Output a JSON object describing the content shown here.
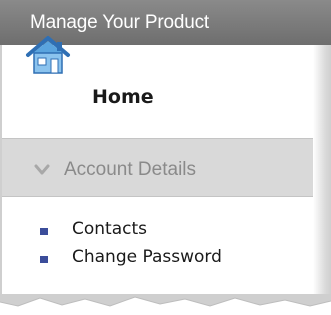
{
  "panel": {
    "title": "Manage Your Product"
  },
  "home": {
    "label": "Home",
    "icon": "house-icon"
  },
  "section": {
    "label": "Account Details",
    "icon": "chevron-down-icon"
  },
  "links": [
    {
      "label": "Contacts"
    },
    {
      "label": "Change Password"
    }
  ],
  "colors": {
    "header_bg": "#7a7a7a",
    "section_bg": "#d9d9d9",
    "bullet": "#3b4d9a"
  }
}
